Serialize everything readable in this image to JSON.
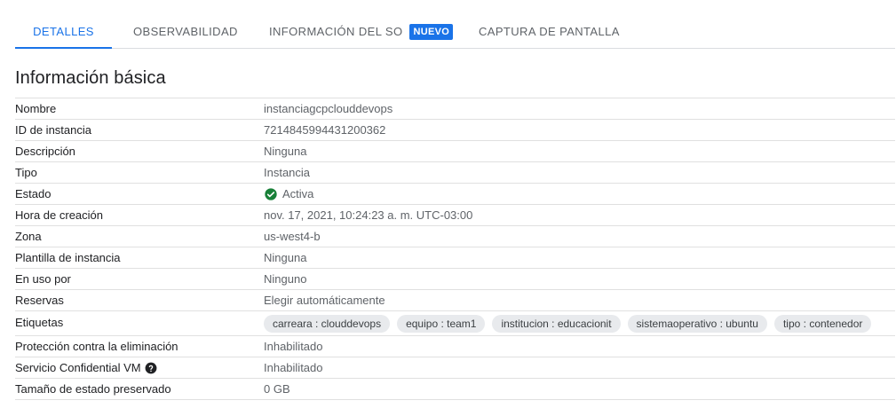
{
  "tabs": [
    {
      "label": "DETALLES"
    },
    {
      "label": "OBSERVABILIDAD"
    },
    {
      "label": "INFORMACIÓN DEL SO",
      "badge": "NUEVO"
    },
    {
      "label": "CAPTURA DE PANTALLA"
    }
  ],
  "active_tab": "DETALLES",
  "accent_color": "#1a73e8",
  "status_color": "#188038",
  "section_title": "Información básica",
  "rows": {
    "name": {
      "label": "Nombre",
      "value": "instanciagcpclouddevops"
    },
    "instance_id": {
      "label": "ID de instancia",
      "value": "7214845994431200362"
    },
    "description": {
      "label": "Descripción",
      "value": "Ninguna"
    },
    "type": {
      "label": "Tipo",
      "value": "Instancia"
    },
    "status": {
      "label": "Estado",
      "value": "Activa",
      "icon": "check-circle-icon"
    },
    "created": {
      "label": "Hora de creación",
      "value": "nov. 17, 2021, 10:24:23 a. m. UTC-03:00"
    },
    "zone": {
      "label": "Zona",
      "value": "us-west4-b"
    },
    "template": {
      "label": "Plantilla de instancia",
      "value": "Ninguna"
    },
    "in_use_by": {
      "label": "En uso por",
      "value": "Ninguno"
    },
    "reservations": {
      "label": "Reservas",
      "value": "Elegir automáticamente"
    },
    "labels": {
      "label": "Etiquetas",
      "chips": [
        "carreara : clouddevops",
        "equipo : team1",
        "institucion : educacionit",
        "sistemaoperativo : ubuntu",
        "tipo : contenedor"
      ]
    },
    "deletion_protection": {
      "label": "Protección contra la eliminación",
      "value": "Inhabilitado"
    },
    "confidential_vm": {
      "label": "Servicio Confidential VM",
      "value": "Inhabilitado",
      "icon": "help-icon"
    },
    "preserved_state": {
      "label": "Tamaño de estado preservado",
      "value": "0 GB"
    }
  }
}
